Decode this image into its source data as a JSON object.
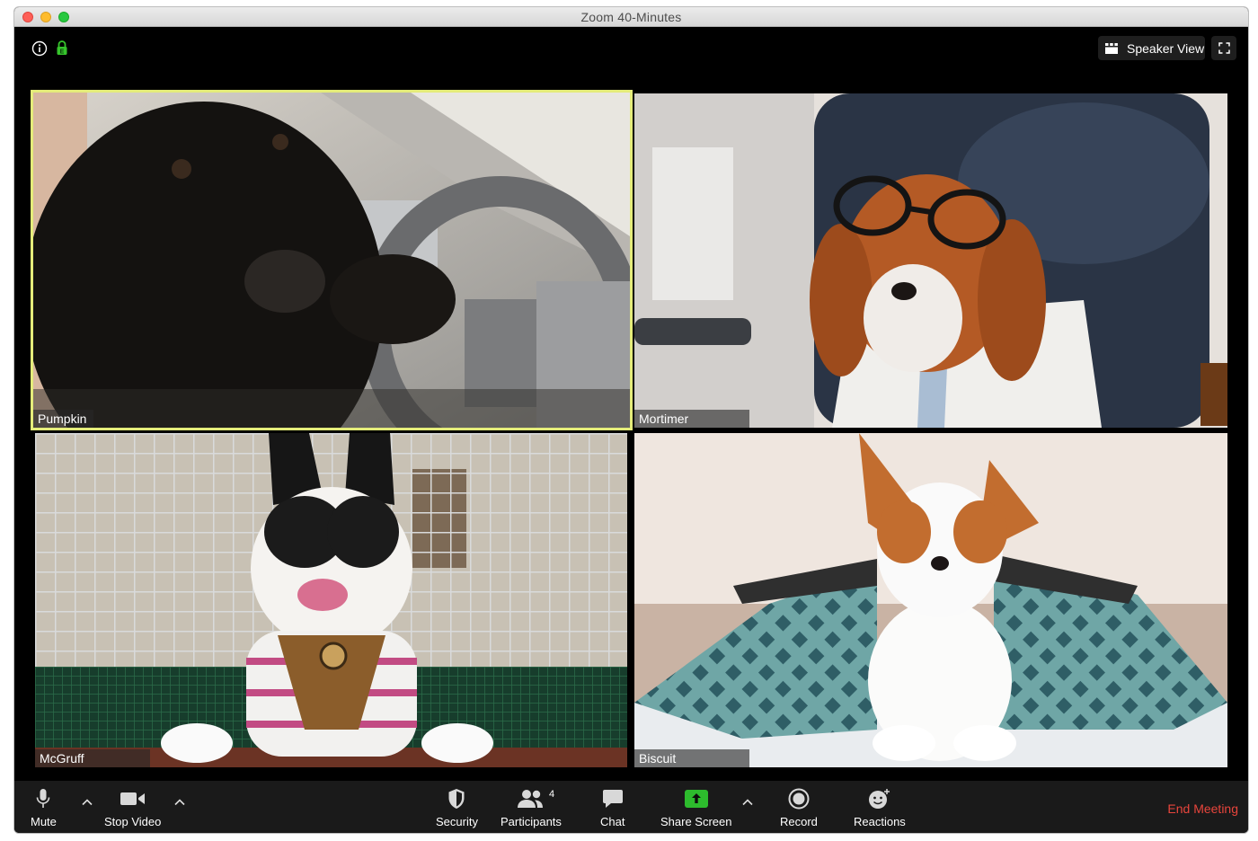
{
  "window": {
    "app": "Zoom",
    "title": "Zoom   40-Minutes"
  },
  "top_bar": {
    "speaker_view_label": "Speaker View"
  },
  "participants": [
    {
      "name": "Pumpkin",
      "active_speaker": true
    },
    {
      "name": "Mortimer",
      "active_speaker": false
    },
    {
      "name": "McGruff",
      "active_speaker": false
    },
    {
      "name": "Biscuit",
      "active_speaker": false
    }
  ],
  "toolbar": {
    "mute_label": "Mute",
    "stop_video_label": "Stop Video",
    "security_label": "Security",
    "participants_label": "Participants",
    "participants_count": "4",
    "chat_label": "Chat",
    "share_screen_label": "Share Screen",
    "record_label": "Record",
    "reactions_label": "Reactions",
    "end_meeting_label": "End Meeting"
  },
  "colors": {
    "active_speaker_border": "#e4ec7a",
    "share_green": "#2dbb2d",
    "end_meeting": "#e8453c",
    "lock_green": "#36c42c"
  },
  "icons": [
    "info-icon",
    "lock-icon",
    "speaker-view-icon",
    "fullscreen-icon",
    "microphone-icon",
    "video-camera-icon",
    "shield-icon",
    "participants-icon",
    "chat-bubble-icon",
    "share-screen-icon",
    "record-icon",
    "reaction-emoji-icon",
    "chevron-up-icon"
  ]
}
